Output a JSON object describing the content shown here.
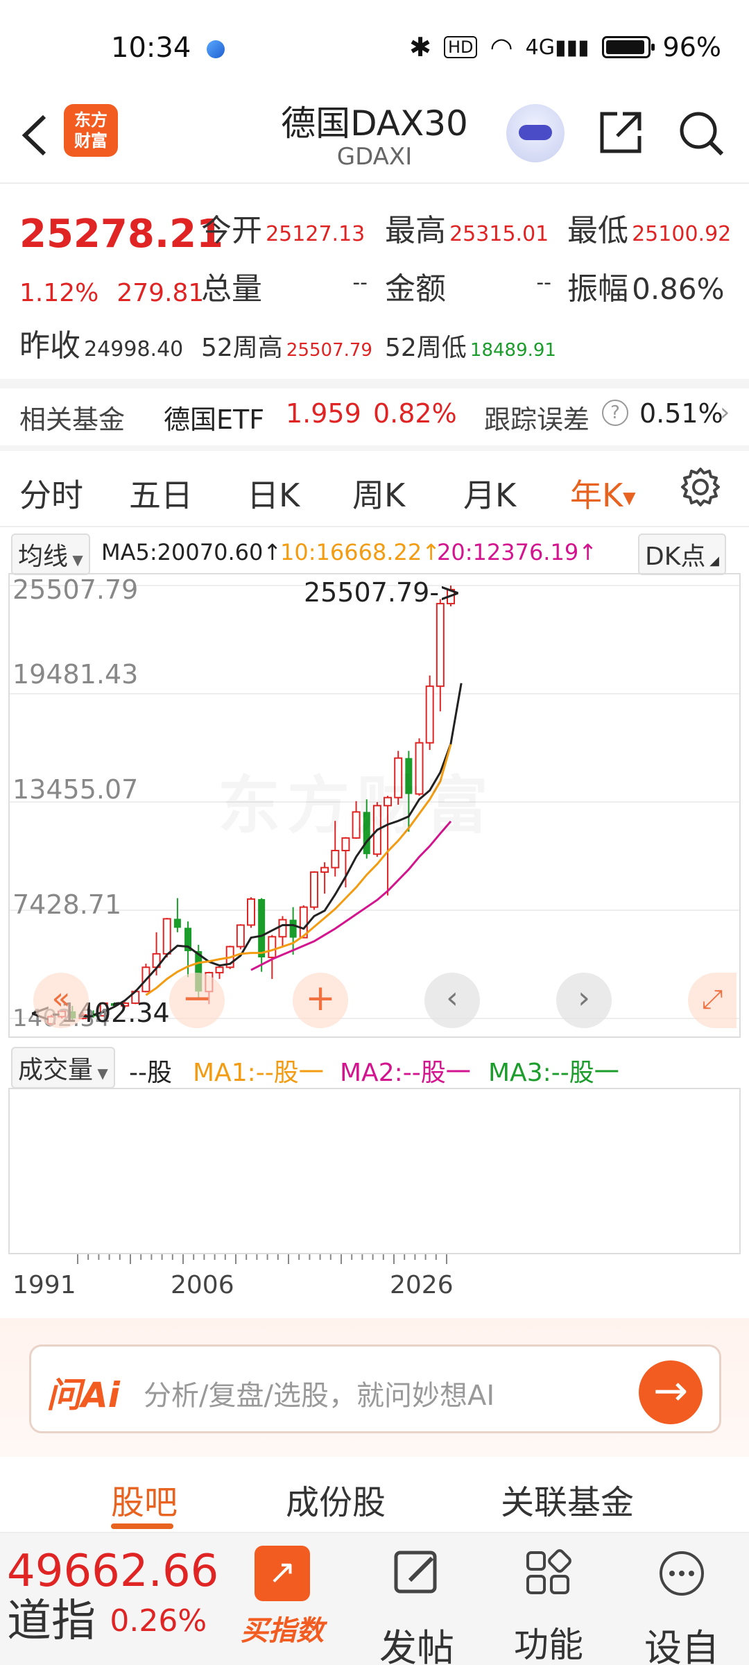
{
  "status": {
    "time": "10:34",
    "battery": "96%",
    "network": "4G"
  },
  "header": {
    "title": "德国DAX30",
    "code": "GDAXI",
    "logo_line1": "东方",
    "logo_line2": "财富"
  },
  "quote": {
    "price": "25278.21",
    "pct": "1.12%",
    "change": "279.81",
    "open_label": "今开",
    "open": "25127.13",
    "high_label": "最高",
    "high": "25315.01",
    "low_label": "最低",
    "low": "25100.92",
    "volume_label": "总量",
    "volume": "--",
    "amount_label": "金额",
    "amount": "--",
    "amp_label": "振幅",
    "amp": "0.86%",
    "prev_label": "昨收",
    "prev": "24998.40",
    "w52h_label": "52周高",
    "w52h": "25507.79",
    "w52l_label": "52周低",
    "w52l": "18489.91"
  },
  "fund": {
    "label": "相关基金",
    "name": "德国ETF",
    "price": "1.959",
    "pct": "0.82%",
    "track_label": "跟踪误差",
    "track": "0.51%"
  },
  "tabs": [
    "分时",
    "五日",
    "日K",
    "周K",
    "月K",
    "年K"
  ],
  "ma": {
    "selector": "均线",
    "ma5": "MA5:20070.60",
    "ma10": "10:16668.22",
    "ma20": "20:12376.19",
    "dk": "DK点"
  },
  "chart": {
    "y_labels": [
      "25507.79",
      "19481.43",
      "13455.07",
      "7428.71",
      "1402.34"
    ],
    "max_annot": "25507.79->",
    "min_annot": "<-1402.34",
    "watermark": "东方财富"
  },
  "chart_data": {
    "type": "candlestick",
    "x_range": [
      1988,
      2026
    ],
    "ylim": [
      1402.34,
      25507.79
    ],
    "candles": [
      [
        1988,
        1100,
        1500,
        1050,
        1600
      ],
      [
        1989,
        1500,
        1800,
        1400,
        1900
      ],
      [
        1990,
        1800,
        1400,
        1300,
        2100
      ],
      [
        1991,
        1400,
        1600,
        1350,
        1750
      ],
      [
        1992,
        1600,
        1550,
        1450,
        1850
      ],
      [
        1993,
        1550,
        2250,
        1500,
        2300
      ],
      [
        1994,
        2250,
        2100,
        2000,
        2300
      ],
      [
        1995,
        2100,
        2250,
        2000,
        2320
      ],
      [
        1996,
        2250,
        2900,
        2200,
        3000
      ],
      [
        1997,
        2900,
        4250,
        2850,
        4450
      ],
      [
        1998,
        4250,
        5000,
        3800,
        6200
      ],
      [
        1999,
        5000,
        6950,
        4800,
        7000
      ],
      [
        2000,
        6950,
        6450,
        6200,
        8100
      ],
      [
        2001,
        6450,
        5150,
        3700,
        6800
      ],
      [
        2002,
        5150,
        2900,
        2500,
        5500
      ],
      [
        2003,
        2900,
        3950,
        2200,
        4000
      ],
      [
        2004,
        3950,
        4250,
        3600,
        4300
      ],
      [
        2005,
        4250,
        5400,
        4150,
        5450
      ],
      [
        2006,
        5400,
        6600,
        5250,
        6650
      ],
      [
        2007,
        6600,
        8050,
        6450,
        8150
      ],
      [
        2008,
        8050,
        4800,
        4000,
        8100
      ],
      [
        2009,
        4800,
        5950,
        3600,
        6050
      ],
      [
        2010,
        5950,
        6900,
        5400,
        7100
      ],
      [
        2011,
        6900,
        5900,
        4950,
        7600
      ],
      [
        2012,
        5900,
        7600,
        5900,
        7700
      ],
      [
        2013,
        7600,
        9550,
        7450,
        9600
      ],
      [
        2014,
        9550,
        9800,
        8350,
        10100
      ],
      [
        2015,
        9800,
        10750,
        9300,
        12400
      ],
      [
        2016,
        10750,
        11450,
        8700,
        11500
      ],
      [
        2017,
        11450,
        12900,
        11400,
        13500
      ],
      [
        2018,
        12900,
        10550,
        10300,
        13600
      ],
      [
        2019,
        10550,
        13250,
        10400,
        13450
      ],
      [
        2020,
        13250,
        13700,
        8250,
        13800
      ],
      [
        2021,
        13700,
        15900,
        13300,
        16300
      ],
      [
        2022,
        15900,
        13900,
        11800,
        16300
      ],
      [
        2023,
        13900,
        16750,
        13800,
        17000
      ],
      [
        2024,
        16750,
        19900,
        16350,
        20500
      ],
      [
        2025,
        19900,
        24500,
        18500,
        24750
      ],
      [
        2026,
        24500,
        25280,
        24350,
        25507.79
      ]
    ],
    "ma_series": [
      {
        "name": "MA5",
        "color": "#222222",
        "start": 1992,
        "values": [
          1600,
          1770,
          2050,
          2400,
          2900,
          3550,
          4200,
          4950,
          5450,
          5400,
          4980,
          4560,
          4350,
          4440,
          4900,
          5900,
          6000,
          6300,
          6600,
          6600,
          6400,
          7100,
          7400,
          8300,
          9300,
          10400,
          11250,
          11900,
          12200,
          12400,
          12650,
          13600,
          14100,
          15100,
          16700,
          20070.6
        ]
      },
      {
        "name": "MA10",
        "color": "#f39c12",
        "start": 1997,
        "values": [
          2700,
          3100,
          3600,
          4000,
          4300,
          4500,
          4580,
          4700,
          4800,
          5000,
          5050,
          5050,
          5200,
          5400,
          5600,
          6000,
          6500,
          7000,
          7500,
          8100,
          8700,
          9400,
          10000,
          10700,
          11300,
          12000,
          12800,
          13600,
          14600,
          16668.22
        ]
      },
      {
        "name": "MA20",
        "color": "#d4148e",
        "start": 2007,
        "values": [
          4100,
          4400,
          4700,
          4950,
          5200,
          5450,
          5700,
          6050,
          6400,
          6800,
          7200,
          7600,
          8000,
          8500,
          9100,
          9700,
          10400,
          11000,
          11700,
          12376.19
        ]
      }
    ]
  },
  "volume": {
    "selector": "成交量",
    "unit": "--股",
    "ma1": "MA1:--股一",
    "ma2": "MA2:--股一",
    "ma3": "MA3:--股一"
  },
  "x_labels": [
    "1991",
    "2006",
    "2026"
  ],
  "ai": {
    "tag": "问Ai",
    "placeholder": "分析/复盘/选股，就问妙想AI"
  },
  "sub_tabs": [
    "股吧",
    "成份股",
    "关联基金"
  ],
  "ticker": {
    "price": "49662.66",
    "name": "道指",
    "pct": "0.26%"
  },
  "nav": [
    "买指数",
    "发帖",
    "功能",
    "设自"
  ],
  "colors": {
    "accent": "#e8631f",
    "up": "#e02424",
    "down": "#1a9d2a"
  }
}
